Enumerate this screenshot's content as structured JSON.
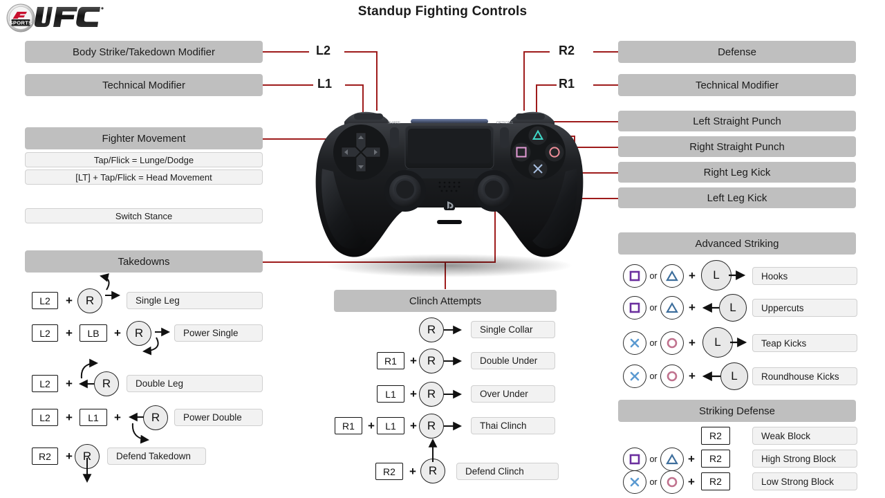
{
  "page": {
    "title": "Standup Fighting Controls",
    "logo_alt": "EA SPORTS UFC",
    "logo_ea": "EA",
    "logo_sports": "SPORTS",
    "logo_ufc": "UFC",
    "accent_color": "#9e1b1b",
    "header_bar_color": "#bfbfbf",
    "light_bar_color": "#f2f2f2"
  },
  "bumpers": {
    "l2": "L2",
    "l1": "L1",
    "r2": "R2",
    "r1": "R1"
  },
  "left_panel": {
    "modifiers": [
      {
        "label": "Body Strike/Takedown Modifier"
      },
      {
        "label": "Technical Modifier"
      }
    ],
    "fighter_movement": {
      "header": "Fighter Movement",
      "rows": [
        "Tap/Flick = Lunge/Dodge",
        "[LT] + Tap/Flick = Head Movement"
      ],
      "switch_stance": "Switch Stance"
    },
    "takedowns": {
      "header": "Takedowns",
      "rows": [
        {
          "tokens": [
            "L2"
          ],
          "stick": "R",
          "result": "Single Leg"
        },
        {
          "tokens": [
            "L2",
            "LB"
          ],
          "stick": "R",
          "result": "Power Single"
        },
        {
          "tokens": [
            "L2"
          ],
          "stick": "R",
          "result": "Double Leg"
        },
        {
          "tokens": [
            "L2",
            "L1"
          ],
          "stick": "R",
          "result": "Power Double"
        },
        {
          "tokens": [
            "R2"
          ],
          "stick": "R",
          "result": "Defend Takedown"
        }
      ]
    }
  },
  "center_panel": {
    "clinch": {
      "header": "Clinch Attempts",
      "rows": [
        {
          "tokens": [],
          "stick": "R",
          "result": "Single Collar"
        },
        {
          "tokens": [
            "R1"
          ],
          "stick": "R",
          "result": "Double Under"
        },
        {
          "tokens": [
            "L1"
          ],
          "stick": "R",
          "result": "Over Under"
        },
        {
          "tokens": [
            "R1",
            "L1"
          ],
          "stick": "R",
          "result": "Thai Clinch"
        },
        {
          "tokens": [
            "R2"
          ],
          "stick": "R",
          "result": "Defend Clinch"
        }
      ]
    }
  },
  "right_panel": {
    "top_bars": [
      {
        "label": "Defense"
      },
      {
        "label": "Technical Modifier"
      },
      {
        "label": "Left Straight Punch"
      },
      {
        "label": "Right Straight Punch"
      },
      {
        "label": "Right Leg Kick"
      },
      {
        "label": "Left Leg Kick"
      }
    ],
    "advanced_striking": {
      "header": "Advanced Striking",
      "or_label": "or",
      "rows": [
        {
          "btn_a": "square",
          "btn_b": "triangle",
          "stick": "L",
          "dir": "right",
          "result": "Hooks"
        },
        {
          "btn_a": "square",
          "btn_b": "triangle",
          "stick": "L",
          "dir": "left",
          "result": "Uppercuts"
        },
        {
          "btn_a": "cross",
          "btn_b": "circle",
          "stick": "L",
          "dir": "right",
          "result": "Teap Kicks"
        },
        {
          "btn_a": "cross",
          "btn_b": "circle",
          "stick": "L",
          "dir": "left",
          "result": "Roundhouse  Kicks"
        }
      ]
    },
    "striking_defense": {
      "header": "Striking Defense",
      "or_label": "or",
      "rows": [
        {
          "btn_a": null,
          "btn_b": null,
          "token": "R2",
          "result": "Weak Block"
        },
        {
          "btn_a": "square",
          "btn_b": "triangle",
          "token": "R2",
          "result": "High Strong  Block"
        },
        {
          "btn_a": "cross",
          "btn_b": "circle",
          "token": "R2",
          "result": "Low Strong  Block"
        }
      ]
    }
  },
  "icons": {
    "square_color": "#6b2f9e",
    "triangle_color": "#3d6e9c",
    "cross_color": "#5b9ad1",
    "circle_color": "#c0728e",
    "pad_square_color": "#e49bd6",
    "pad_triangle_color": "#3fd8c8",
    "pad_circle_color": "#f08f9a",
    "pad_cross_color": "#a8bfe0"
  },
  "controller": {
    "share_label": "SHARE",
    "options_label": "OPTIONS"
  }
}
